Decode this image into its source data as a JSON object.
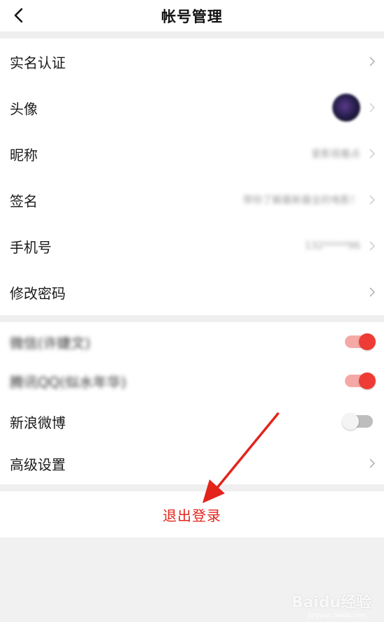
{
  "header": {
    "title": "帐号管理"
  },
  "section1": [
    {
      "label": "实名认证",
      "value": ""
    },
    {
      "label": "头像",
      "value": ""
    },
    {
      "label": "昵称",
      "value": "爱影视看点"
    },
    {
      "label": "签名",
      "value": "带你了解最新最全的电影！"
    },
    {
      "label": "手机号",
      "value": "132*****96"
    },
    {
      "label": "修改密码",
      "value": ""
    }
  ],
  "section2": {
    "wechat": {
      "label": "微信(许婕文)",
      "state": "on"
    },
    "qq": {
      "label": "腾讯QQ(似水年华)",
      "state": "on"
    },
    "weibo": {
      "label": "新浪微博",
      "state": "off"
    },
    "advanced": {
      "label": "高级设置"
    }
  },
  "logout": {
    "label": "退出登录"
  },
  "watermark": {
    "text": "Baidu经验",
    "sub": "jingyan.baidu.com"
  },
  "colors": {
    "accent": "#ef3b35",
    "logout": "#e3241b"
  }
}
